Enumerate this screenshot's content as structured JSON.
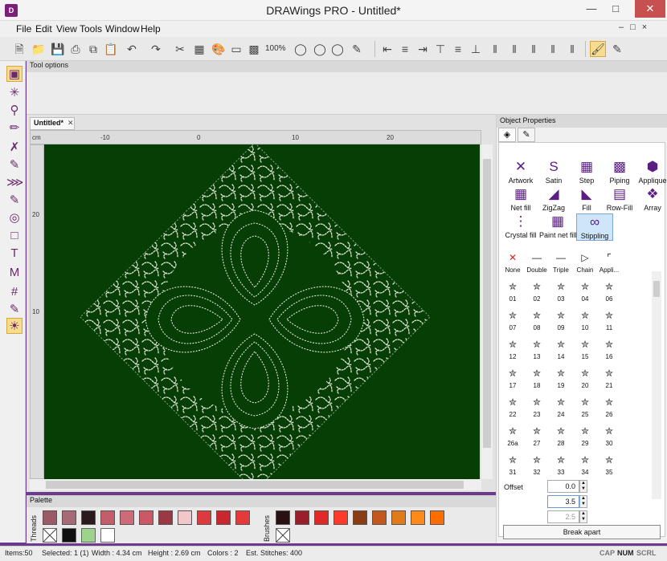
{
  "window": {
    "title": "DRAWings PRO - Untitled*",
    "icon": "app-logo"
  },
  "menu": [
    "File",
    "Edit",
    "View",
    "Tools",
    "Window",
    "Help"
  ],
  "toolbar": {
    "zoom": "100%"
  },
  "tool_options": {
    "title": "Tool options"
  },
  "document": {
    "tab_label": "Untitled*",
    "ruler_unit": "cm",
    "h_ruler_ticks": [
      "-10",
      "0",
      "10",
      "20"
    ],
    "v_ruler_ticks": [
      "20",
      "10"
    ]
  },
  "palette": {
    "title": "Palette",
    "threads_label": "Threads",
    "brushes_label": "Brushes",
    "thread_colors": [
      "#9b5a66",
      "#a76b77",
      "#2a1a1d",
      "#c45d6a",
      "#cf6b78",
      "#cc5865",
      "#9a3943",
      "#f1c7c9",
      "#dd3a40",
      "#c9262d",
      "#e43a3a"
    ],
    "brush_colors": [
      "#2a0f13",
      "#9a1f2b",
      "#e02a2a",
      "#ff3a2a",
      "#8a3c12",
      "#c4581c",
      "#e07a1a",
      "#ff8a1a",
      "#ff6d00"
    ]
  },
  "object_properties": {
    "title": "Object Properties",
    "stitch_types": [
      "Artwork",
      "Satin",
      "Step",
      "Piping",
      "Applique",
      "Net fill",
      "ZigZag",
      "Fill",
      "Row-Fill",
      "Array",
      "Crystal fill",
      "Paint net fill",
      "Stippling"
    ],
    "selected_type": "Stippling",
    "patterns": [
      "None",
      "Double",
      "Triple",
      "Chain",
      "Appli...",
      "01",
      "02",
      "03",
      "04",
      "06",
      "07",
      "08",
      "09",
      "10",
      "11",
      "12",
      "13",
      "14",
      "15",
      "16",
      "17",
      "18",
      "19",
      "20",
      "21",
      "22",
      "23",
      "24",
      "25",
      "26",
      "26a",
      "27",
      "28",
      "29",
      "30",
      "31",
      "32",
      "33",
      "34",
      "35"
    ],
    "offset_label": "Offset",
    "offset_value": "0.0",
    "spin2_value": "3.5",
    "spin3_value": "2.5",
    "break_apart": "Break apart"
  },
  "status": {
    "items": "Items:50",
    "selected": "Selected: 1 (1)",
    "width": "Width : 4.34 cm",
    "height": "Height : 2.69 cm",
    "colors": "Colors : 2",
    "stitches": "Est. Stitches: 400",
    "keys": [
      "CAP",
      "NUM",
      "SCRL"
    ]
  },
  "colors": {
    "canvas": "#063e06",
    "stitch": "#dfe7d6",
    "accent": "#5b1d82",
    "titlebar_close": "#c75050"
  }
}
